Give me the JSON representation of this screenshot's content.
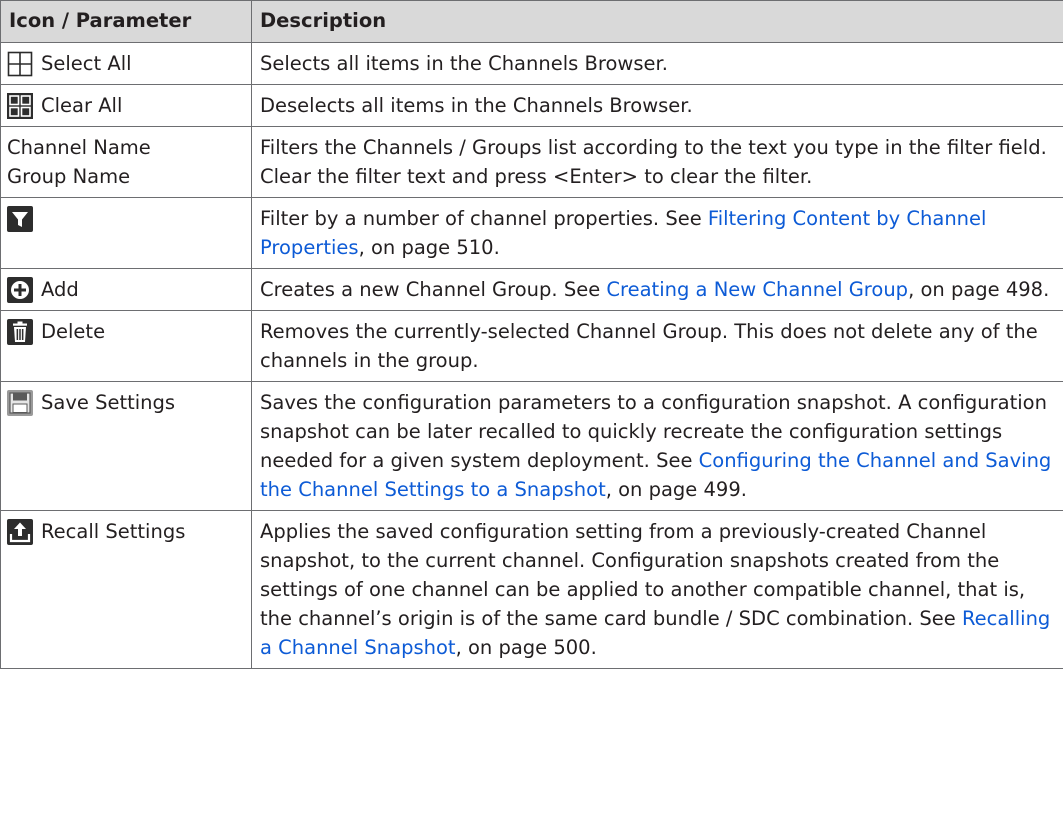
{
  "table": {
    "headers": [
      "Icon / Parameter",
      "Description"
    ],
    "rows": {
      "select_all": {
        "label": "Select All",
        "icon": "select-all-icon",
        "desc": "Selects all items in the Channels Browser."
      },
      "clear_all": {
        "label": "Clear All",
        "icon": "clear-all-icon",
        "desc": "Deselects all items in the Channels Browser."
      },
      "channel_name": {
        "label_line1": "Channel Name",
        "label_line2": "Group Name",
        "desc": "Filters the Channels / Groups list according to the text you type in the filter field. Clear the filter text and press <Enter> to clear the filter."
      },
      "filter": {
        "icon": "filter-icon",
        "desc_pre": "Filter by a number of channel properties. See ",
        "link": "Filtering Content by Channel Properties",
        "desc_post": ", on page 510."
      },
      "add": {
        "label": "Add",
        "icon": "add-icon",
        "desc_pre": "Creates a new Channel Group. See ",
        "link": "Creating a New Channel Group",
        "desc_post": ", on page 498."
      },
      "delete": {
        "label": "Delete",
        "icon": "trash-icon",
        "desc": "Removes the currently-selected Channel Group. This does not delete any of the channels in the group."
      },
      "save_settings": {
        "label": "Save Settings",
        "icon": "save-icon",
        "desc_pre": "Saves the configuration parameters to a configuration snapshot. A configuration snapshot can be later recalled to quickly recreate the configuration settings needed for a given system deployment. See ",
        "link": "Configuring the Channel and Saving the Channel Settings to a Snapshot",
        "desc_post": ", on page 499."
      },
      "recall_settings": {
        "label": "Recall Settings",
        "icon": "upload-icon",
        "desc_pre": "Applies the saved configuration setting from a previously-created Channel snapshot, to the current channel. Configuration snapshots created from the settings of one channel can be applied to another compatible channel, that is, the channel’s origin is of the same card bundle / SDC combination. See ",
        "link": "Recalling a Channel Snapshot",
        "desc_post": ", on page 500."
      }
    }
  }
}
